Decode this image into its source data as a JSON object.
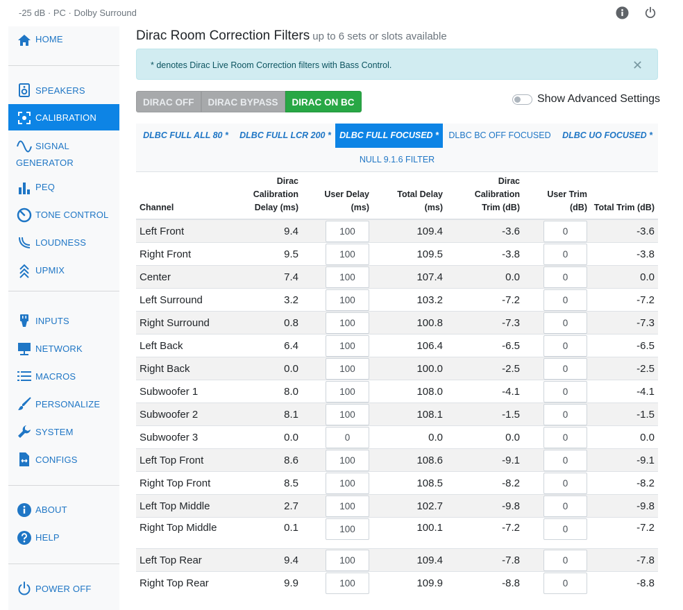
{
  "status_bar": {
    "text": "-25 dB · PC · Dolby Surround"
  },
  "colors": {
    "accent": "#0d84e5",
    "link": "#1f76c5",
    "success": "#28a745",
    "alert_bg": "#d1ecf1"
  },
  "icons": {
    "info": "info-icon",
    "power": "power-icon",
    "close": "close-icon",
    "home": "home-icon",
    "speakers": "speaker-icon",
    "calibration": "calibration-icon",
    "signal_generator": "wave-icon",
    "peq": "bar-chart-icon",
    "tone_control": "gauge-icon",
    "loudness": "loudness-icon",
    "upmix": "upmix-icon",
    "inputs": "plug-icon",
    "network": "monitor-icon",
    "macros": "list-icon",
    "personalize": "brush-icon",
    "system": "wrench-icon",
    "configs": "file-exchange-icon",
    "about": "info-icon",
    "help": "help-icon",
    "power_off": "power-icon"
  },
  "sidebar": {
    "home": "HOME",
    "speakers": "SPEAKERS",
    "calibration": "CALIBRATION",
    "signal_generator_line1": "SIGNAL",
    "signal_generator_line2": "GENERATOR",
    "peq": "PEQ",
    "tone_control": "TONE CONTROL",
    "loudness": "LOUDNESS",
    "upmix": "UPMIX",
    "inputs": "INPUTS",
    "network": "NETWORK",
    "macros": "MACROS",
    "personalize": "PERSONALIZE",
    "system": "SYSTEM",
    "configs": "CONFIGS",
    "about": "ABOUT",
    "help": "HELP",
    "power_off": "POWER OFF"
  },
  "header": {
    "title": "Dirac Room Correction Filters",
    "subtitle": "up to 6 sets or slots available"
  },
  "alert": {
    "text": "* denotes Dirac Live Room Correction filters with Bass Control."
  },
  "modes": {
    "off": "DIRAC OFF",
    "bypass": "DIRAC BYPASS",
    "on": "DIRAC ON BC",
    "selected": "DIRAC ON BC"
  },
  "advanced": {
    "label": "Show Advanced Settings",
    "enabled": false
  },
  "filter_tabs": {
    "t1": "DLBC FULL ALL 80 *",
    "t2": "DLBC FULL LCR 200 *",
    "t3": "DLBC FULL FOCUSED *",
    "t4": "DLBC BC OFF FOCUSED",
    "t5": "DLBC UO FOCUSED *",
    "t6": "NULL 9.1.6 FILTER",
    "selected": "DLBC FULL FOCUSED *"
  },
  "table": {
    "headers": {
      "channel": "Channel",
      "cal_delay_1": "Dirac",
      "cal_delay_2": "Calibration",
      "cal_delay_3": "Delay (ms)",
      "user_delay_1": "User Delay",
      "user_delay_2": "(ms)",
      "total_delay_1": "Total Delay",
      "total_delay_2": "(ms)",
      "cal_trim_1": "Dirac",
      "cal_trim_2": "Calibration",
      "cal_trim_3": "Trim (dB)",
      "user_trim_1": "User Trim",
      "user_trim_2": "(dB)",
      "total_trim": "Total Trim (dB)"
    },
    "rows": [
      {
        "name": "Left Front",
        "cal_delay": "9.4",
        "user_delay": "100",
        "total_delay": "109.4",
        "cal_trim": "-3.6",
        "user_trim": "0",
        "total_trim": "-3.6"
      },
      {
        "name": "Right Front",
        "cal_delay": "9.5",
        "user_delay": "100",
        "total_delay": "109.5",
        "cal_trim": "-3.8",
        "user_trim": "0",
        "total_trim": "-3.8"
      },
      {
        "name": "Center",
        "cal_delay": "7.4",
        "user_delay": "100",
        "total_delay": "107.4",
        "cal_trim": "0.0",
        "user_trim": "0",
        "total_trim": "0.0"
      },
      {
        "name": "Left Surround",
        "cal_delay": "3.2",
        "user_delay": "100",
        "total_delay": "103.2",
        "cal_trim": "-7.2",
        "user_trim": "0",
        "total_trim": "-7.2"
      },
      {
        "name": "Right Surround",
        "cal_delay": "0.8",
        "user_delay": "100",
        "total_delay": "100.8",
        "cal_trim": "-7.3",
        "user_trim": "0",
        "total_trim": "-7.3"
      },
      {
        "name": "Left Back",
        "cal_delay": "6.4",
        "user_delay": "100",
        "total_delay": "106.4",
        "cal_trim": "-6.5",
        "user_trim": "0",
        "total_trim": "-6.5"
      },
      {
        "name": "Right Back",
        "cal_delay": "0.0",
        "user_delay": "100",
        "total_delay": "100.0",
        "cal_trim": "-2.5",
        "user_trim": "0",
        "total_trim": "-2.5"
      },
      {
        "name": "Subwoofer 1",
        "cal_delay": "8.0",
        "user_delay": "100",
        "total_delay": "108.0",
        "cal_trim": "-4.1",
        "user_trim": "0",
        "total_trim": "-4.1"
      },
      {
        "name": "Subwoofer 2",
        "cal_delay": "8.1",
        "user_delay": "100",
        "total_delay": "108.1",
        "cal_trim": "-1.5",
        "user_trim": "0",
        "total_trim": "-1.5"
      },
      {
        "name": "Subwoofer 3",
        "cal_delay": "0.0",
        "user_delay": "0",
        "total_delay": "0.0",
        "cal_trim": "0.0",
        "user_trim": "0",
        "total_trim": "0.0"
      },
      {
        "name": "Left Top Front",
        "cal_delay": "8.6",
        "user_delay": "100",
        "total_delay": "108.6",
        "cal_trim": "-9.1",
        "user_trim": "0",
        "total_trim": "-9.1"
      },
      {
        "name": "Right Top Front",
        "cal_delay": "8.5",
        "user_delay": "100",
        "total_delay": "108.5",
        "cal_trim": "-8.2",
        "user_trim": "0",
        "total_trim": "-8.2"
      },
      {
        "name": "Left Top Middle",
        "cal_delay": "2.7",
        "user_delay": "100",
        "total_delay": "102.7",
        "cal_trim": "-9.8",
        "user_trim": "0",
        "total_trim": "-9.8"
      },
      {
        "name": "Right Top Middle",
        "cal_delay": "0.1",
        "user_delay": "100",
        "total_delay": "100.1",
        "cal_trim": "-7.2",
        "user_trim": "0",
        "total_trim": "-7.2"
      },
      {
        "name": "Left Top Rear",
        "cal_delay": "9.4",
        "user_delay": "100",
        "total_delay": "109.4",
        "cal_trim": "-7.8",
        "user_trim": "0",
        "total_trim": "-7.8"
      },
      {
        "name": "Right Top Rear",
        "cal_delay": "9.9",
        "user_delay": "100",
        "total_delay": "109.9",
        "cal_trim": "-8.8",
        "user_trim": "0",
        "total_trim": "-8.8"
      }
    ]
  }
}
